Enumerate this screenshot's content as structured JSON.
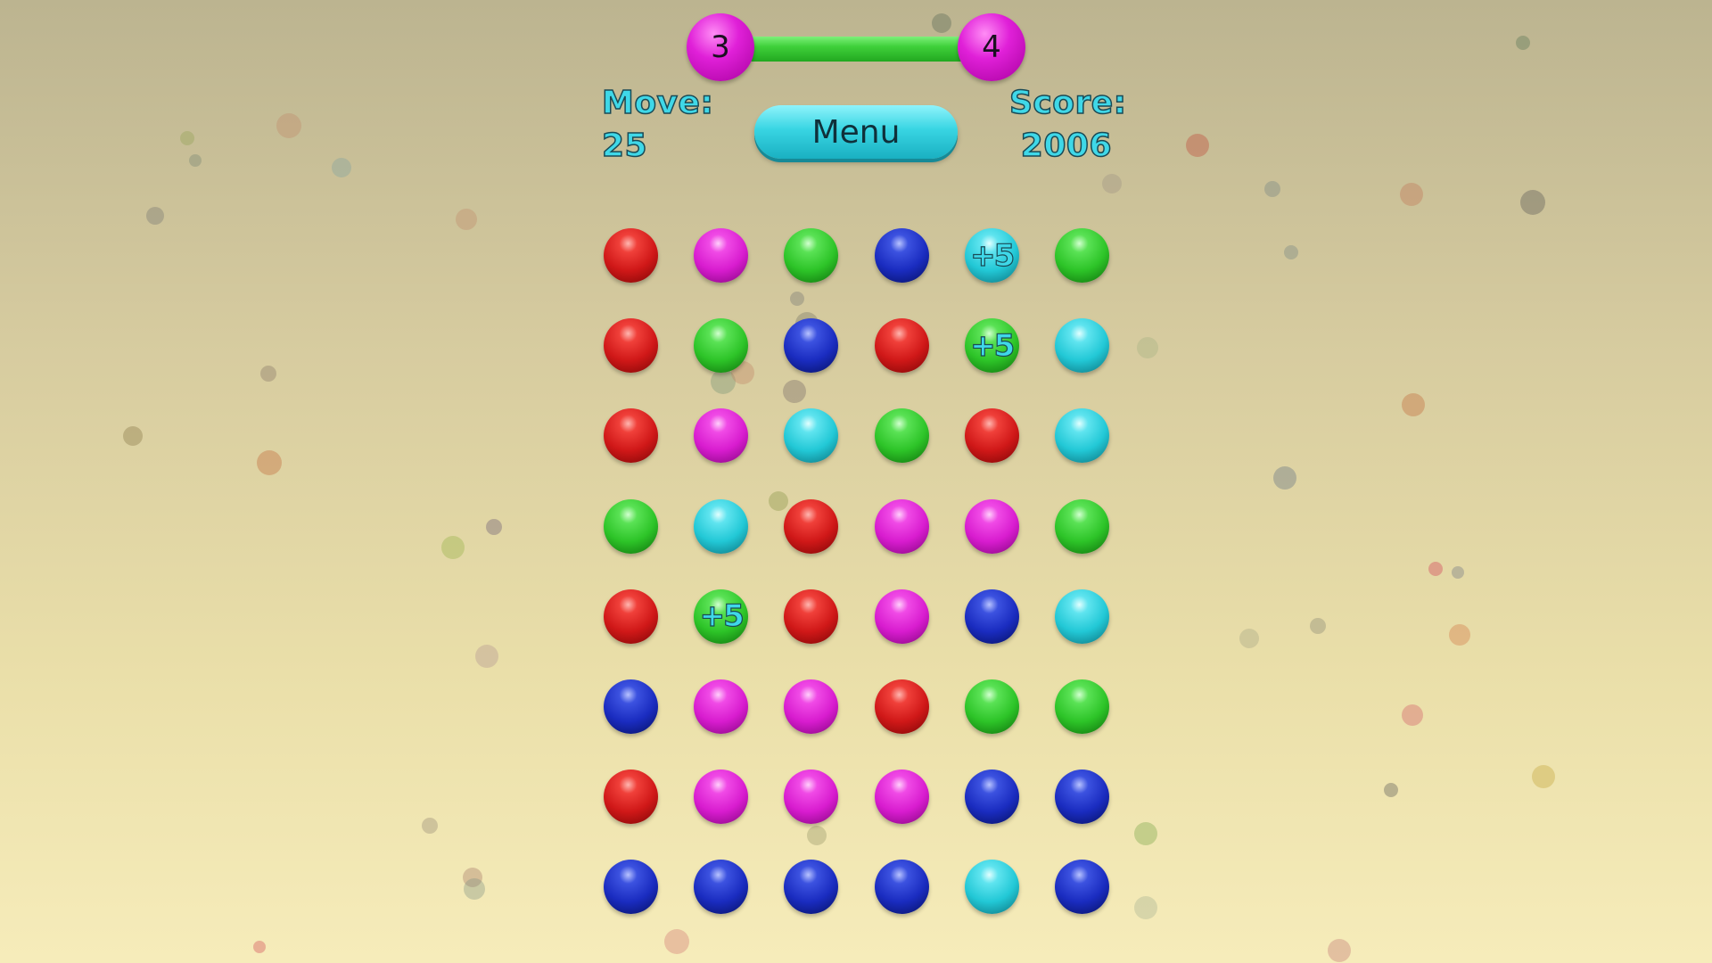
{
  "level": {
    "current": "3",
    "next": "4",
    "progress": 1.0
  },
  "hud": {
    "move_label": "Move:",
    "move_value": "25",
    "score_label": "Score:",
    "score_value": "2006",
    "menu_label": "Menu"
  },
  "colors": {
    "red": "#d01818",
    "magenta": "#d81ccf",
    "green": "#2dc428",
    "blue": "#1a2cc0",
    "cyan": "#22c8d6",
    "hud_text": "#3fd8e8"
  },
  "grid": {
    "rows": [
      [
        {
          "color": "red"
        },
        {
          "color": "magenta"
        },
        {
          "color": "green"
        },
        {
          "color": "blue"
        },
        {
          "color": "cyan",
          "bonus": "+5"
        },
        {
          "color": "green"
        }
      ],
      [
        {
          "color": "red"
        },
        {
          "color": "green"
        },
        {
          "color": "blue"
        },
        {
          "color": "red"
        },
        {
          "color": "green",
          "bonus": "+5"
        },
        {
          "color": "cyan"
        }
      ],
      [
        {
          "color": "red"
        },
        {
          "color": "magenta"
        },
        {
          "color": "cyan"
        },
        {
          "color": "green"
        },
        {
          "color": "red"
        },
        {
          "color": "cyan"
        }
      ],
      [
        {
          "color": "green"
        },
        {
          "color": "cyan"
        },
        {
          "color": "red"
        },
        {
          "color": "magenta"
        },
        {
          "color": "magenta"
        },
        {
          "color": "green"
        }
      ],
      [
        {
          "color": "red"
        },
        {
          "color": "green",
          "bonus": "+5"
        },
        {
          "color": "red"
        },
        {
          "color": "magenta"
        },
        {
          "color": "blue"
        },
        {
          "color": "cyan"
        }
      ],
      [
        {
          "color": "blue"
        },
        {
          "color": "magenta"
        },
        {
          "color": "magenta"
        },
        {
          "color": "red"
        },
        {
          "color": "green"
        },
        {
          "color": "green"
        }
      ],
      [
        {
          "color": "red"
        },
        {
          "color": "magenta"
        },
        {
          "color": "magenta"
        },
        {
          "color": "magenta"
        },
        {
          "color": "blue"
        },
        {
          "color": "blue"
        }
      ],
      [
        {
          "color": "blue"
        },
        {
          "color": "blue"
        },
        {
          "color": "blue"
        },
        {
          "color": "blue"
        },
        {
          "color": "cyan"
        },
        {
          "color": "blue"
        }
      ]
    ]
  }
}
